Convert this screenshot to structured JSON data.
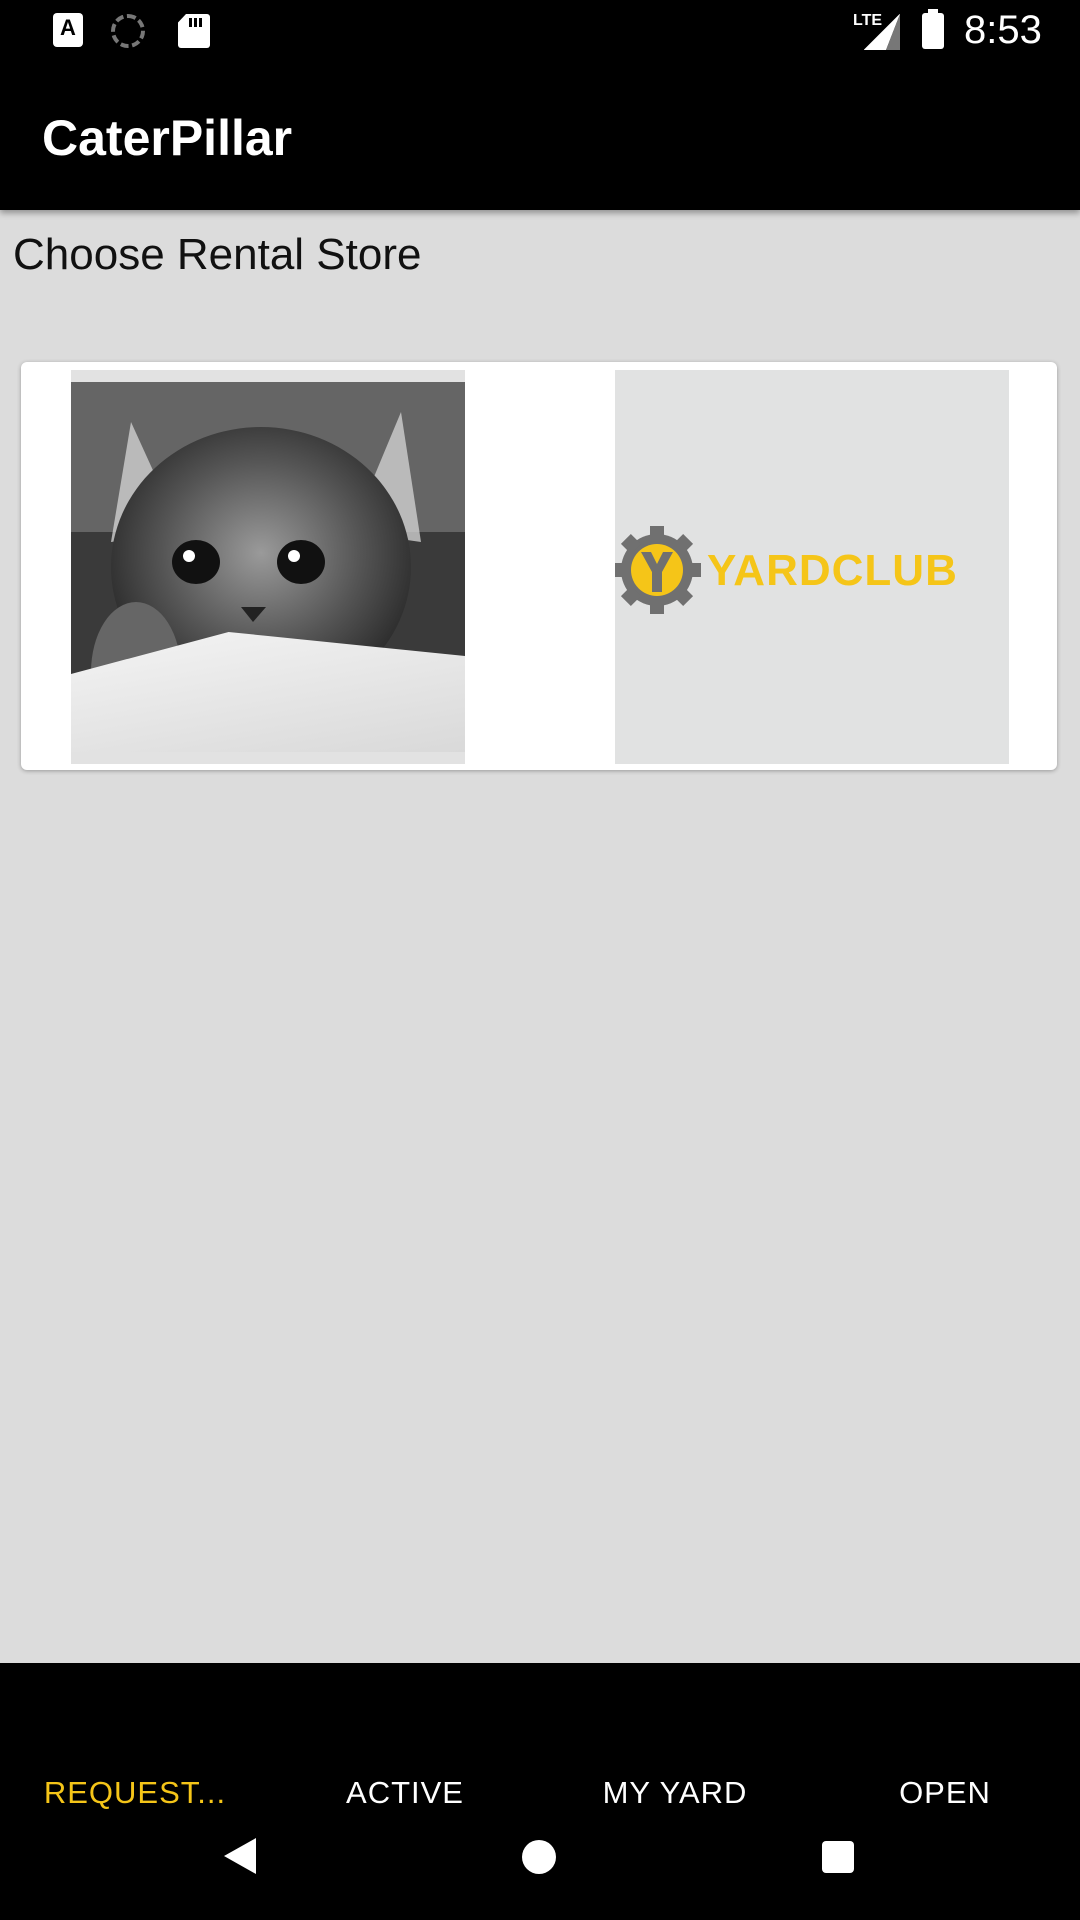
{
  "status_bar": {
    "time": "8:53",
    "network": "LTE",
    "icons": [
      "app-a-icon",
      "loading-spinner-icon",
      "sd-card-icon",
      "lte-icon",
      "signal-icon",
      "battery-icon"
    ]
  },
  "app_bar": {
    "title": "CaterPillar"
  },
  "content": {
    "heading": "Choose Rental Store",
    "stores": [
      {
        "name": "kitten-store",
        "image": "kitten-photo"
      },
      {
        "name": "yardclub-store",
        "logo_text": "YARDCLUB",
        "logo_color": "#f5c518",
        "gear_color": "#707070"
      }
    ]
  },
  "bottom_nav": {
    "tabs": [
      {
        "label": "REQUEST...",
        "active": true
      },
      {
        "label": "ACTIVE",
        "active": false
      },
      {
        "label": "MY YARD",
        "active": false
      },
      {
        "label": "OPEN",
        "active": false
      }
    ],
    "active_color": "#f5c518"
  },
  "system_nav": [
    "back-icon",
    "home-icon",
    "recents-icon"
  ]
}
